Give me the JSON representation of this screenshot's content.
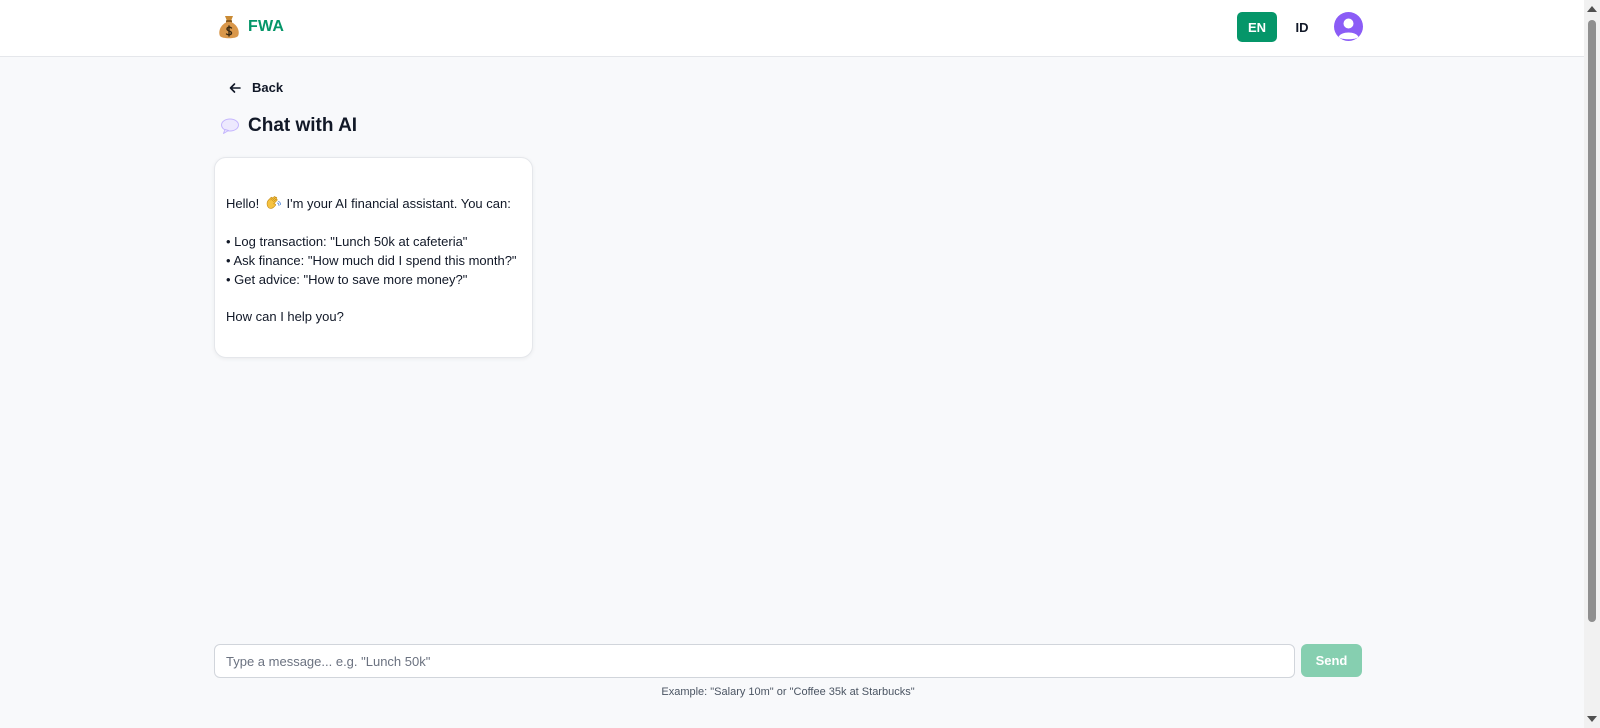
{
  "header": {
    "brand_icon": "money-bag-icon",
    "brand_name": "FWA",
    "lang_en": "EN",
    "lang_id": "ID",
    "accent_color": "#059669",
    "avatar_color": "#8b5cf6"
  },
  "nav": {
    "back_label": "Back",
    "back_icon": "arrow-left-icon"
  },
  "page": {
    "title_icon": "speech-bubble-icon",
    "title": "Chat with AI"
  },
  "chat": {
    "messages": [
      {
        "role": "assistant",
        "greeting_start": "Hello!",
        "greeting_icon": "waving-hand-icon",
        "greeting_end": "I'm your AI financial assistant. You can:",
        "items": [
          "• Log transaction: \"Lunch 50k at cafeteria\"",
          "• Ask finance: \"How much did I spend this month?\"",
          "• Get advice: \"How to save more money?\""
        ],
        "closing": "How can I help you?"
      }
    ]
  },
  "composer": {
    "placeholder": "Type a message... e.g. \"Lunch 50k\"",
    "value": "",
    "send_label": "Send",
    "send_color": "#86cfb0",
    "hint": "Example: \"Salary 10m\" or \"Coffee 35k at Starbucks\""
  }
}
